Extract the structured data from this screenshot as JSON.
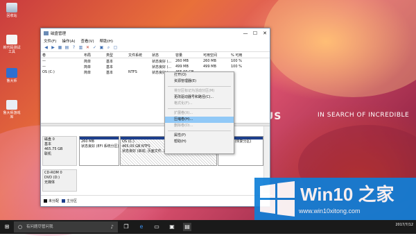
{
  "desktop": {
    "icons": [
      "回收站",
      "新代码测试工具",
      "鲁大师",
      "鲁大师游戏库"
    ],
    "brand_logo": "ASUS",
    "brand_slogan": "IN SEARCH OF INCREDIBLE"
  },
  "window": {
    "title": "磁盘管理",
    "menu": [
      "文件(F)",
      "操作(A)",
      "查看(V)",
      "帮助(H)"
    ],
    "controls": {
      "minimize": "—",
      "maximize": "☐",
      "close": "✕"
    },
    "volume_columns": [
      "卷",
      "布局",
      "类型",
      "文件系统",
      "状态",
      "容量",
      "可用空间",
      "% 可用"
    ],
    "volumes": [
      [
        "—",
        "简单",
        "基本",
        "",
        "状态良好 (...",
        "260 MB",
        "260 MB",
        "100 %"
      ],
      [
        "—",
        "简单",
        "基本",
        "",
        "状态良好 (...",
        "499 MB",
        "499 MB",
        "100 %"
      ],
      [
        "OS (C:)",
        "简单",
        "基本",
        "NTFS",
        "状态良好 (...",
        "465.00 GB",
        "",
        ""
      ]
    ],
    "context_menu": [
      {
        "label": "打开(O)",
        "enabled": true
      },
      {
        "label": "资源管理器(E)",
        "enabled": true
      },
      {
        "label": "将分区标记为活动分区(M)",
        "enabled": false
      },
      {
        "label": "更改驱动器号和路径(C)...",
        "enabled": true
      },
      {
        "label": "格式化(F)...",
        "enabled": false
      },
      {
        "label": "扩展卷(X)...",
        "enabled": false
      },
      {
        "label": "压缩卷(H)...",
        "enabled": true,
        "selected": true
      },
      {
        "label": "删除卷(D)...",
        "enabled": false
      },
      {
        "label": "属性(P)",
        "enabled": true
      },
      {
        "label": "帮助(H)",
        "enabled": true
      }
    ],
    "disk0": {
      "name": "磁盘 0",
      "type": "基本",
      "size": "465.75 GB",
      "status": "联机",
      "partitions": [
        {
          "size": "260 MB",
          "status": "状态良好 (EFI 系统分区)"
        },
        {
          "name": "OS (C:)",
          "size": "465.00 GB NTFS",
          "status": "状态良好 (启动, 页面文件, 故障转储, 主分区)"
        },
        {
          "size": "",
          "status": "状态良好 (恢复分区)"
        }
      ]
    },
    "cdrom0": {
      "name": "CD-ROM 0",
      "type": "DVD (D:)",
      "media": "无媒体"
    },
    "legend": [
      "未分配",
      "主分区"
    ],
    "legend_colors": [
      "#111111",
      "#1d3f8c"
    ]
  },
  "watermark": {
    "title": "Win10 之家",
    "url": "www.win10xitong.com"
  },
  "taskbar": {
    "search_placeholder": "有问题尽管问我",
    "time": "2017/7/12"
  }
}
